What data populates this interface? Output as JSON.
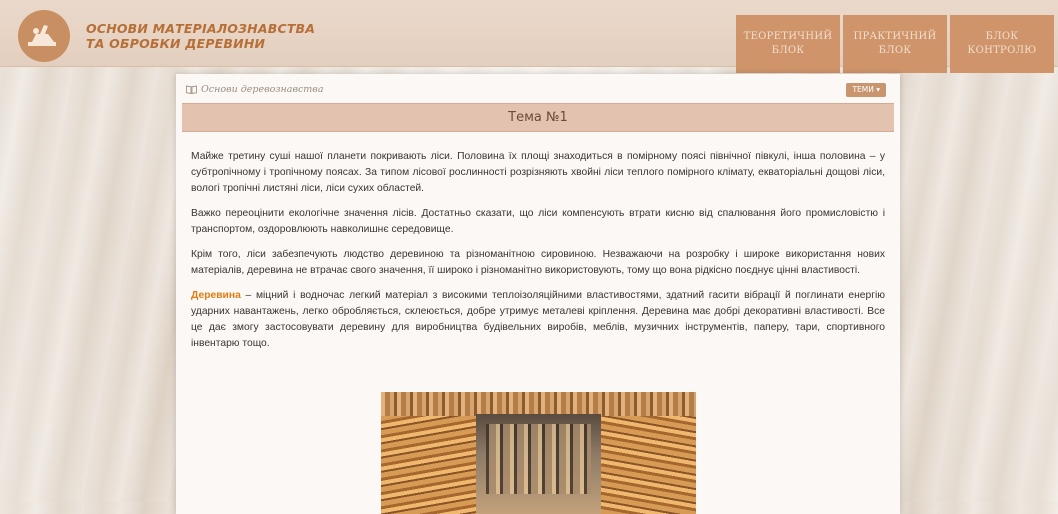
{
  "header": {
    "brand_line1": "ОСНОВИ МАТЕРІАЛОЗНАВСТВА",
    "brand_line2": "ТА ОБРОБКИ ДЕРЕВИНИ",
    "nav": [
      {
        "label": "ТЕОРЕТИЧНИЙ\nБЛОК"
      },
      {
        "label": "ПРАКТИЧНИЙ\nБЛОК"
      },
      {
        "label": "БЛОК\nКОНТРОЛЮ"
      }
    ],
    "colors": {
      "accent": "#cf946a",
      "brand_text": "#b66f37"
    }
  },
  "page": {
    "breadcrumb": "Основи деревознавства",
    "topics_button": "ТЕМИ ▾",
    "title": "Тема №1",
    "paragraphs": [
      "Майже третину суші нашої планети покривають ліси. Половина їх площі знаходиться в помірному поясі північної півкулі, інша половина – у субтропічному і тропічному поясах. За типом лісової рослинності розрізняють хвойні ліси теплого помірного клімату, екваторіальні дощові ліси, вологі тропічні листяні ліси, ліси сухих областей.",
      "Важко переоцінити екологічне значення лісів. Достатньо сказати, що ліси компенсують втрати кисню від спалювання його промисловістю і транспортом, оздоровлюють навколишнє середовище.",
      "Крім того, ліси забезпечують людство деревиною та різноманітною сировиною. Незважаючи на розробку і широке використання нових матеріалів, деревина не втрачає свого значення, її широко і різноманітно використовують, тому що вона рідкісно поєднує цінні властивості."
    ],
    "p4_highlight": "Деревина",
    "p4_rest": " – міцний і водночас легкий матеріал з високими теплоізоляційними властивостями, здатний гасити вібрації й поглинати енергію ударних навантажень, легко обробляється, склеюється, добре утримує металеві кріплення. Деревина має добрі декоративні властивості. Все це дає змогу застосовувати деревину для виробництва будівельних виробів, меблів, музичних інструментів, паперу, тари, спортивного інвентарю тощо."
  },
  "icons": {
    "logo": "wood-plane-icon",
    "breadcrumb": "book-icon"
  }
}
